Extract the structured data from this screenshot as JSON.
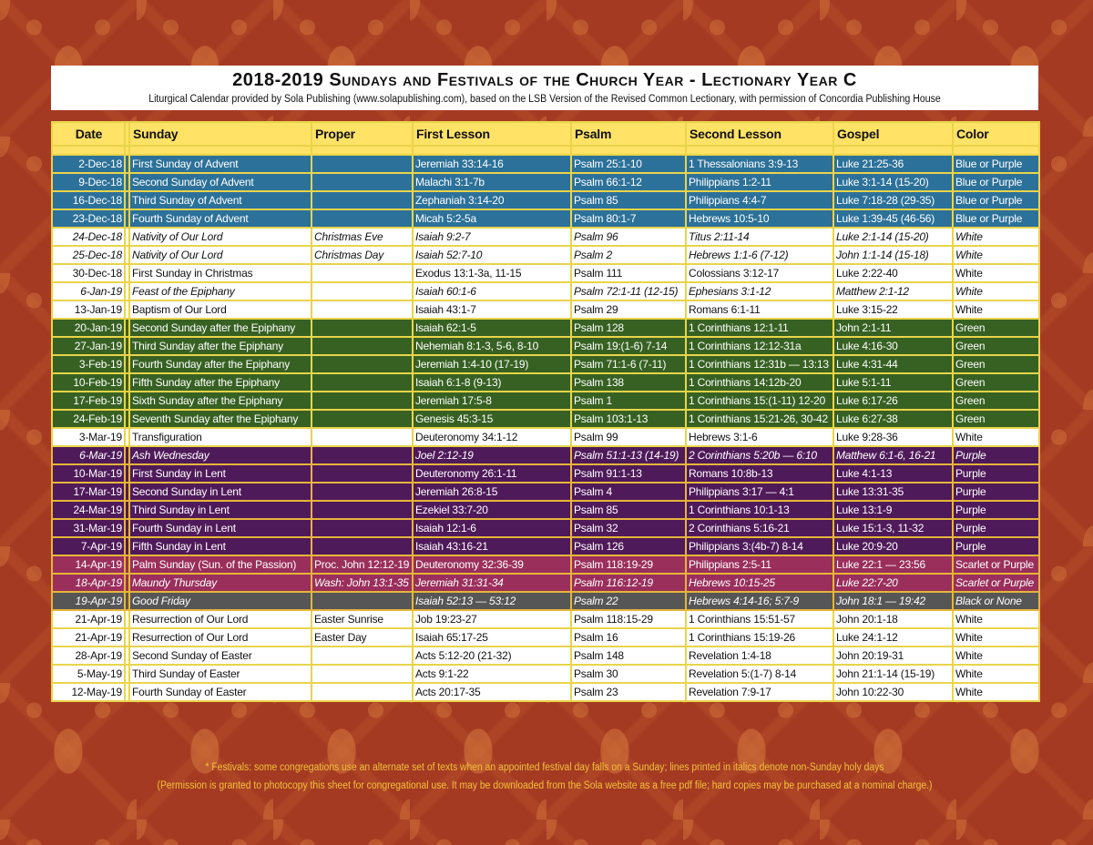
{
  "header": {
    "title": "2018-2019 Sundays and Festivals of the Church Year - Lectionary Year C",
    "subtitle": "Liturgical Calendar provided by Sola Publishing (www.solapublishing.com), based on the LSB Version of the Revised Common Lectionary, with permission of Concordia Publishing House"
  },
  "colors": {
    "background": "#a43a22",
    "header_row": "#ffe266",
    "grid": "#e9d44a",
    "blue": "#2c7199",
    "white": "#ffffff",
    "green": "#376122",
    "purple": "#4f1a5a",
    "scarlet": "#9a2f5c",
    "black": "#565656",
    "footer_text": "#f3c23a"
  },
  "table": {
    "columns": [
      "Date",
      "",
      "Sunday",
      "Proper",
      "First Lesson",
      "Psalm",
      "Second Lesson",
      "Gospel",
      "Color"
    ],
    "rows": [
      {
        "date": "2-Dec-18",
        "sunday": "First Sunday of Advent",
        "proper": "",
        "first": "Jeremiah 33:14-16",
        "psalm": "Psalm 25:1-10",
        "second": "1 Thessalonians 3:9-13",
        "gospel": "Luke 21:25-36",
        "color": "Blue or Purple",
        "style": "blue",
        "italic": false
      },
      {
        "date": "9-Dec-18",
        "sunday": "Second Sunday of Advent",
        "proper": "",
        "first": "Malachi 3:1-7b",
        "psalm": "Psalm 66:1-12",
        "second": "Philippians 1:2-11",
        "gospel": "Luke 3:1-14 (15-20)",
        "color": "Blue or Purple",
        "style": "blue",
        "italic": false
      },
      {
        "date": "16-Dec-18",
        "sunday": "Third Sunday of Advent",
        "proper": "",
        "first": "Zephaniah 3:14-20",
        "psalm": "Psalm 85",
        "second": "Philippians 4:4-7",
        "gospel": "Luke 7:18-28 (29-35)",
        "color": "Blue or Purple",
        "style": "blue",
        "italic": false
      },
      {
        "date": "23-Dec-18",
        "sunday": "Fourth Sunday of Advent",
        "proper": "",
        "first": "Micah 5:2-5a",
        "psalm": "Psalm 80:1-7",
        "second": "Hebrews 10:5-10",
        "gospel": "Luke 1:39-45 (46-56)",
        "color": "Blue or Purple",
        "style": "blue",
        "italic": false
      },
      {
        "date": "24-Dec-18",
        "sunday": "Nativity of Our Lord",
        "proper": "Christmas Eve",
        "first": "Isaiah 9:2-7",
        "psalm": "Psalm 96",
        "second": "Titus 2:11-14",
        "gospel": "Luke 2:1-14 (15-20)",
        "color": "White",
        "style": "white",
        "italic": true
      },
      {
        "date": "25-Dec-18",
        "sunday": "Nativity of Our Lord",
        "proper": "Christmas Day",
        "first": "Isaiah 52:7-10",
        "psalm": "Psalm 2",
        "second": "Hebrews 1:1-6 (7-12)",
        "gospel": "John 1:1-14 (15-18)",
        "color": "White",
        "style": "white",
        "italic": true
      },
      {
        "date": "30-Dec-18",
        "sunday": "First Sunday in Christmas",
        "proper": "",
        "first": "Exodus 13:1-3a, 11-15",
        "psalm": "Psalm 111",
        "second": "Colossians 3:12-17",
        "gospel": "Luke 2:22-40",
        "color": "White",
        "style": "white",
        "italic": false
      },
      {
        "date": "6-Jan-19",
        "sunday": "Feast of the Epiphany",
        "proper": "",
        "first": "Isaiah 60:1-6",
        "psalm": "Psalm 72:1-11 (12-15)",
        "second": "Ephesians 3:1-12",
        "gospel": "Matthew 2:1-12",
        "color": "White",
        "style": "white",
        "italic": true
      },
      {
        "date": "13-Jan-19",
        "sunday": "Baptism of Our Lord",
        "proper": "",
        "first": "Isaiah 43:1-7",
        "psalm": "Psalm 29",
        "second": "Romans 6:1-11",
        "gospel": "Luke 3:15-22",
        "color": "White",
        "style": "white",
        "italic": false
      },
      {
        "date": "20-Jan-19",
        "sunday": "Second Sunday after the Epiphany",
        "proper": "",
        "first": "Isaiah 62:1-5",
        "psalm": "Psalm 128",
        "second": "1 Corinthians 12:1-11",
        "gospel": "John 2:1-11",
        "color": "Green",
        "style": "green",
        "italic": false
      },
      {
        "date": "27-Jan-19",
        "sunday": "Third Sunday after the Epiphany",
        "proper": "",
        "first": "Nehemiah 8:1-3, 5-6, 8-10",
        "psalm": "Psalm 19:(1-6) 7-14",
        "second": "1 Corinthians 12:12-31a",
        "gospel": "Luke 4:16-30",
        "color": "Green",
        "style": "green",
        "italic": false
      },
      {
        "date": "3-Feb-19",
        "sunday": "Fourth Sunday after the Epiphany",
        "proper": "",
        "first": "Jeremiah 1:4-10 (17-19)",
        "psalm": "Psalm 71:1-6 (7-11)",
        "second": "1 Corinthians 12:31b — 13:13",
        "gospel": "Luke 4:31-44",
        "color": "Green",
        "style": "green",
        "italic": false
      },
      {
        "date": "10-Feb-19",
        "sunday": "Fifth Sunday after the Epiphany",
        "proper": "",
        "first": "Isaiah 6:1-8 (9-13)",
        "psalm": "Psalm 138",
        "second": "1 Corinthians 14:12b-20",
        "gospel": "Luke 5:1-11",
        "color": "Green",
        "style": "green",
        "italic": false
      },
      {
        "date": "17-Feb-19",
        "sunday": "Sixth Sunday after the Epiphany",
        "proper": "",
        "first": "Jeremiah 17:5-8",
        "psalm": "Psalm 1",
        "second": "1 Corinthians 15:(1-11) 12-20",
        "gospel": "Luke 6:17-26",
        "color": "Green",
        "style": "green",
        "italic": false
      },
      {
        "date": "24-Feb-19",
        "sunday": "Seventh Sunday after the Epiphany",
        "proper": "",
        "first": "Genesis 45:3-15",
        "psalm": "Psalm 103:1-13",
        "second": "1 Corinthians 15:21-26, 30-42",
        "gospel": "Luke 6:27-38",
        "color": "Green",
        "style": "green",
        "italic": false
      },
      {
        "date": "3-Mar-19",
        "sunday": "Transfiguration",
        "proper": "",
        "first": "Deuteronomy 34:1-12",
        "psalm": "Psalm 99",
        "second": "Hebrews 3:1-6",
        "gospel": "Luke 9:28-36",
        "color": "White",
        "style": "white",
        "italic": false
      },
      {
        "date": "6-Mar-19",
        "sunday": "Ash Wednesday",
        "proper": "",
        "first": "Joel 2:12-19",
        "psalm": "Psalm 51:1-13 (14-19)",
        "second": "2 Corinthians 5:20b — 6:10",
        "gospel": "Matthew 6:1-6, 16-21",
        "color": "Purple",
        "style": "purple",
        "italic": true
      },
      {
        "date": "10-Mar-19",
        "sunday": "First Sunday in Lent",
        "proper": "",
        "first": "Deuteronomy 26:1-11",
        "psalm": "Psalm 91:1-13",
        "second": "Romans 10:8b-13",
        "gospel": "Luke 4:1-13",
        "color": "Purple",
        "style": "purple",
        "italic": false
      },
      {
        "date": "17-Mar-19",
        "sunday": "Second Sunday in Lent",
        "proper": "",
        "first": "Jeremiah 26:8-15",
        "psalm": "Psalm 4",
        "second": "Philippians 3:17 — 4:1",
        "gospel": "Luke 13:31-35",
        "color": "Purple",
        "style": "purple",
        "italic": false
      },
      {
        "date": "24-Mar-19",
        "sunday": "Third Sunday in Lent",
        "proper": "",
        "first": "Ezekiel 33:7-20",
        "psalm": "Psalm 85",
        "second": "1 Corinthians 10:1-13",
        "gospel": "Luke 13:1-9",
        "color": "Purple",
        "style": "purple",
        "italic": false
      },
      {
        "date": "31-Mar-19",
        "sunday": "Fourth Sunday in Lent",
        "proper": "",
        "first": "Isaiah 12:1-6",
        "psalm": "Psalm 32",
        "second": "2 Corinthians 5:16-21",
        "gospel": "Luke 15:1-3, 11-32",
        "color": "Purple",
        "style": "purple",
        "italic": false
      },
      {
        "date": "7-Apr-19",
        "sunday": "Fifth Sunday in Lent",
        "proper": "",
        "first": "Isaiah 43:16-21",
        "psalm": "Psalm 126",
        "second": "Philippians 3:(4b-7) 8-14",
        "gospel": "Luke 20:9-20",
        "color": "Purple",
        "style": "purple",
        "italic": false
      },
      {
        "date": "14-Apr-19",
        "sunday": "Palm Sunday (Sun. of the Passion)",
        "proper": "Proc. John 12:12-19",
        "first": "Deuteronomy 32:36-39",
        "psalm": "Psalm 118:19-29",
        "second": "Philippians 2:5-11",
        "gospel": "Luke 22:1 — 23:56",
        "color": "Scarlet or Purple",
        "style": "scarlet",
        "italic": false
      },
      {
        "date": "18-Apr-19",
        "sunday": "Maundy Thursday",
        "proper": "Wash: John 13:1-35",
        "first": "Jeremiah 31:31-34",
        "psalm": "Psalm 116:12-19",
        "second": "Hebrews 10:15-25",
        "gospel": "Luke 22:7-20",
        "color": "Scarlet or Purple",
        "style": "scarlet",
        "italic": true
      },
      {
        "date": "19-Apr-19",
        "sunday": "Good Friday",
        "proper": "",
        "first": "Isaiah 52:13 — 53:12",
        "psalm": "Psalm 22",
        "second": "Hebrews 4:14-16; 5:7-9",
        "gospel": "John 18:1 — 19:42",
        "color": "Black or None",
        "style": "black",
        "italic": true
      },
      {
        "date": "21-Apr-19",
        "sunday": "Resurrection of Our Lord",
        "proper": "Easter Sunrise",
        "first": "Job 19:23-27",
        "psalm": "Psalm 118:15-29",
        "second": "1 Corinthians 15:51-57",
        "gospel": "John 20:1-18",
        "color": "White",
        "style": "white",
        "italic": false
      },
      {
        "date": "21-Apr-19",
        "sunday": "Resurrection of Our Lord",
        "proper": "Easter Day",
        "first": "Isaiah 65:17-25",
        "psalm": "Psalm 16",
        "second": "1 Corinthians 15:19-26",
        "gospel": "Luke 24:1-12",
        "color": "White",
        "style": "white",
        "italic": false
      },
      {
        "date": "28-Apr-19",
        "sunday": "Second Sunday of Easter",
        "proper": "",
        "first": "Acts 5:12-20 (21-32)",
        "psalm": "Psalm 148",
        "second": "Revelation 1:4-18",
        "gospel": "John 20:19-31",
        "color": "White",
        "style": "white",
        "italic": false
      },
      {
        "date": "5-May-19",
        "sunday": "Third Sunday of Easter",
        "proper": "",
        "first": "Acts 9:1-22",
        "psalm": "Psalm 30",
        "second": "Revelation 5:(1-7) 8-14",
        "gospel": "John 21:1-14 (15-19)",
        "color": "White",
        "style": "white",
        "italic": false
      },
      {
        "date": "12-May-19",
        "sunday": "Fourth Sunday of Easter",
        "proper": "",
        "first": "Acts 20:17-35",
        "psalm": "Psalm 23",
        "second": "Revelation 7:9-17",
        "gospel": "John 10:22-30",
        "color": "White",
        "style": "white",
        "italic": false
      }
    ]
  },
  "footer": {
    "note": "* Festivals: some congregations use an alternate set of texts when an appointed festival day falls on a Sunday; lines printed in italics denote non-Sunday holy days",
    "permission": "(Permission is granted to photocopy this sheet for congregational use. It may be downloaded from the Sola website as a free pdf file; hard copies may be purchased at a nominal charge.)"
  }
}
